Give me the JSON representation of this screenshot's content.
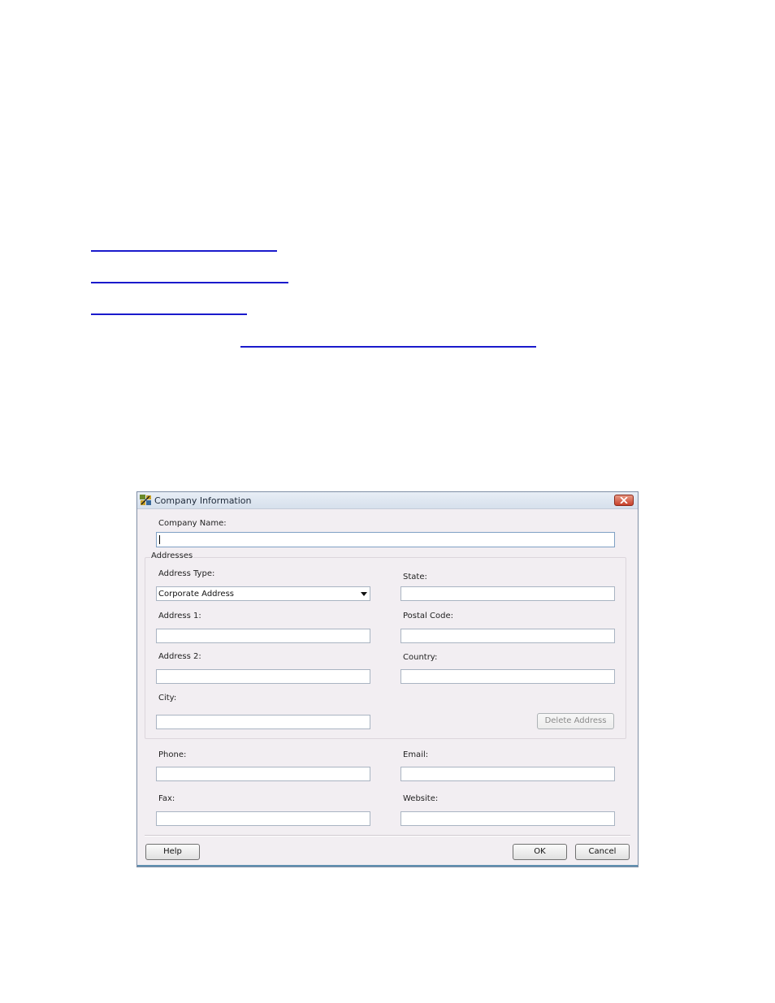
{
  "dialog": {
    "title": "Company Information",
    "company_name_label": "Company Name:",
    "company_name_value": "",
    "addresses_group_label": "Addresses",
    "address_type_label": "Address Type:",
    "address_type_value": "Corporate Address",
    "address1_label": "Address 1:",
    "address2_label": "Address 2:",
    "city_label": "City:",
    "state_label": "State:",
    "postal_code_label": "Postal Code:",
    "country_label": "Country:",
    "delete_address_label": "Delete Address",
    "phone_label": "Phone:",
    "email_label": "Email:",
    "fax_label": "Fax:",
    "website_label": "Website:",
    "help_label": "Help",
    "ok_label": "OK",
    "cancel_label": "Cancel"
  },
  "colors": {
    "link": "#1a1acc",
    "dialog_bg": "#f2eef2",
    "close_button": "#c8412a"
  }
}
